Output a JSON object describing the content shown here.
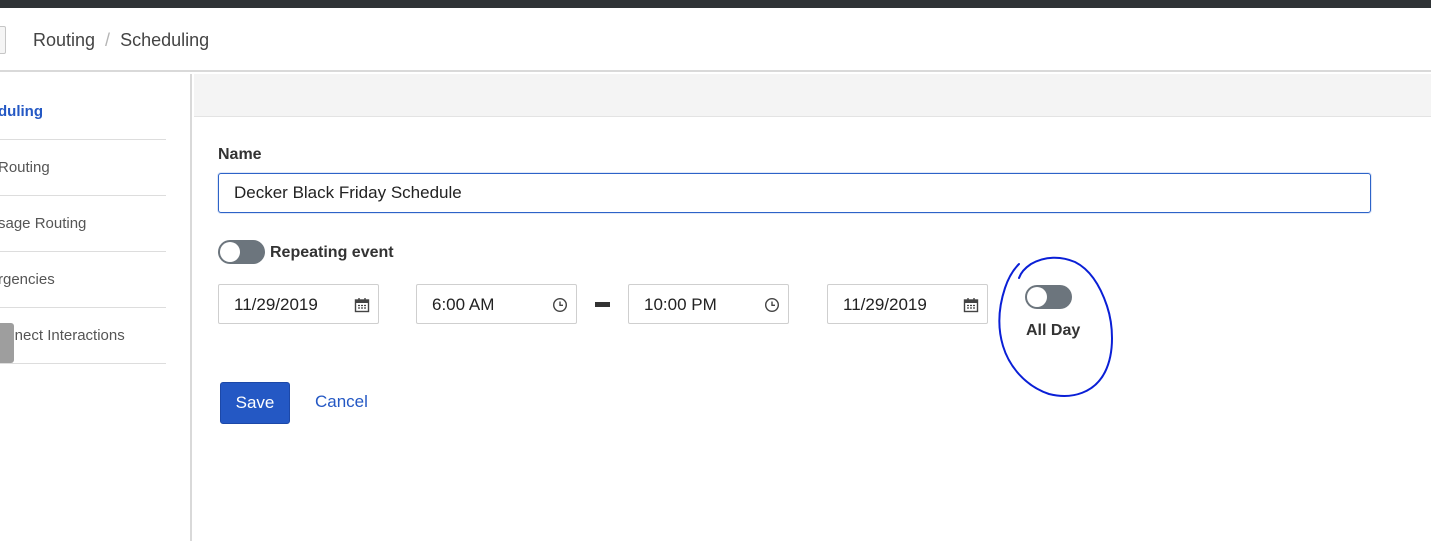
{
  "breadcrumb": {
    "items": [
      "Routing",
      "Scheduling"
    ],
    "separator": "/"
  },
  "sidebar": {
    "items": [
      {
        "label": "duling",
        "active": true
      },
      {
        "label": "Routing",
        "active": false
      },
      {
        "label": "sage Routing",
        "active": false
      },
      {
        "label": "rgencies",
        "active": false
      },
      {
        "label": "onnect Interactions",
        "active": false
      }
    ]
  },
  "form": {
    "name_label": "Name",
    "name_value": "Decker Black Friday Schedule",
    "repeating_label": "Repeating event",
    "repeating_on": false,
    "start_date": "11/29/2019",
    "start_time": "6:00 AM",
    "end_time": "10:00 PM",
    "end_date": "11/29/2019",
    "all_day_label": "All Day",
    "all_day_on": false
  },
  "actions": {
    "save_label": "Save",
    "cancel_label": "Cancel"
  },
  "icons": {
    "date": "calendar-icon",
    "time": "clock-icon"
  },
  "colors": {
    "accent": "#2458c4",
    "toggle_off": "#6c757d",
    "annotation": "#0a1fd6",
    "topbar": "#2f3336"
  }
}
